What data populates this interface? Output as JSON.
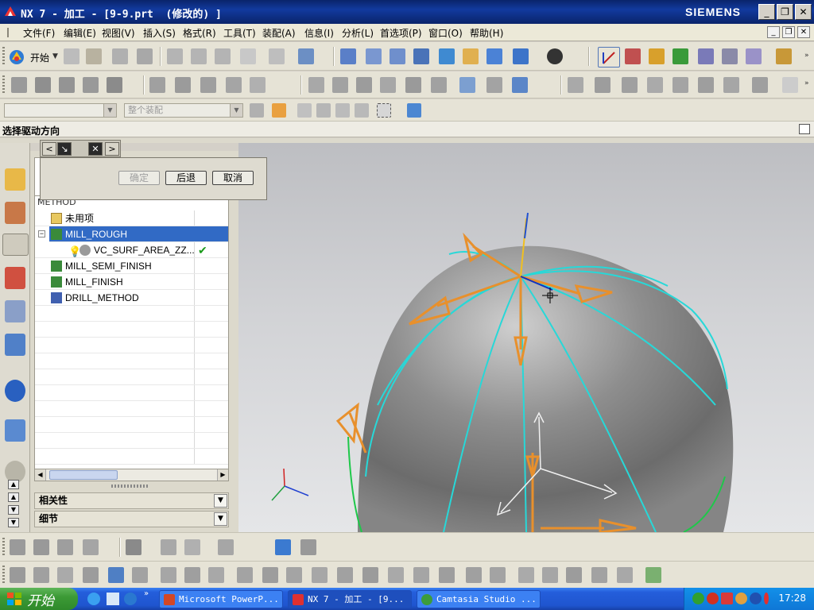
{
  "window": {
    "title": "NX 7 - 加工 - [9-9.prt  (修改的) ]",
    "brand": "SIEMENS",
    "controls": {
      "minimize": "_",
      "maximize": "❐",
      "close": "✕"
    }
  },
  "menu": {
    "items": [
      "文件(F)",
      "编辑(E)",
      "视图(V)",
      "插入(S)",
      "格式(R)",
      "工具(T)",
      "装配(A)",
      "信息(I)",
      "分析(L)",
      "首选项(P)",
      "窗口(O)",
      "帮助(H)"
    ]
  },
  "toolbar": {
    "start_label": "开始",
    "filter_combo": "",
    "assembly_combo": "整个装配"
  },
  "cue_line": "选择驱动方向",
  "dialog": {
    "ok": "确定",
    "back": "后退",
    "cancel": "取消"
  },
  "navigator": {
    "header": "METHOD",
    "rows": [
      {
        "label": "未用项",
        "selected": false,
        "check": ""
      },
      {
        "label": "MILL_ROUGH",
        "selected": true,
        "check": ""
      },
      {
        "label": "VC_SURF_AREA_ZZ...",
        "selected": false,
        "check": "✔"
      },
      {
        "label": "MILL_SEMI_FINISH",
        "selected": false,
        "check": ""
      },
      {
        "label": "MILL_FINISH",
        "selected": false,
        "check": ""
      },
      {
        "label": "DRILL_METHOD",
        "selected": false,
        "check": ""
      }
    ],
    "sections": {
      "dependencies": "相关性",
      "details": "细节"
    }
  },
  "taskbar": {
    "start": "开始",
    "tasks": [
      "Microsoft PowerP...",
      "NX 7 - 加工 - [9...",
      "Camtasia Studio ..."
    ],
    "clock": "17:28"
  },
  "colors": {
    "title_bar": "#0a246a",
    "selection": "#316ac5",
    "drive_vector": "#e8902c",
    "boundary_curve": "#27d8d8",
    "taskbar": "#245edb"
  }
}
